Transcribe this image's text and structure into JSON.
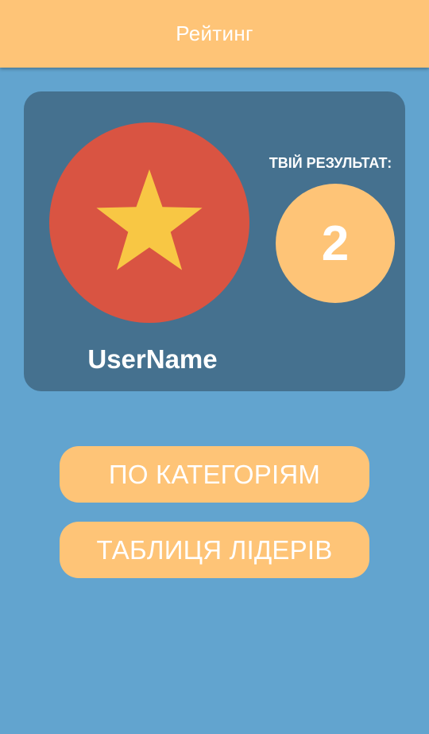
{
  "appbar": {
    "title": "Рейтинг"
  },
  "profile": {
    "username": "UserName",
    "avatar_icon": "star-icon",
    "avatar_color": "#d95442",
    "star_color": "#f8c744"
  },
  "result": {
    "label": "ТВІЙ РЕЗУЛЬТАТ:",
    "score": "2"
  },
  "buttons": {
    "by_categories": "ПО КАТЕГОРІЯМ",
    "leaderboard": "ТАБЛИЦЯ ЛІДЕРІВ"
  },
  "colors": {
    "background": "#62a4cf",
    "card": "#45718f",
    "accent": "#fec477"
  }
}
